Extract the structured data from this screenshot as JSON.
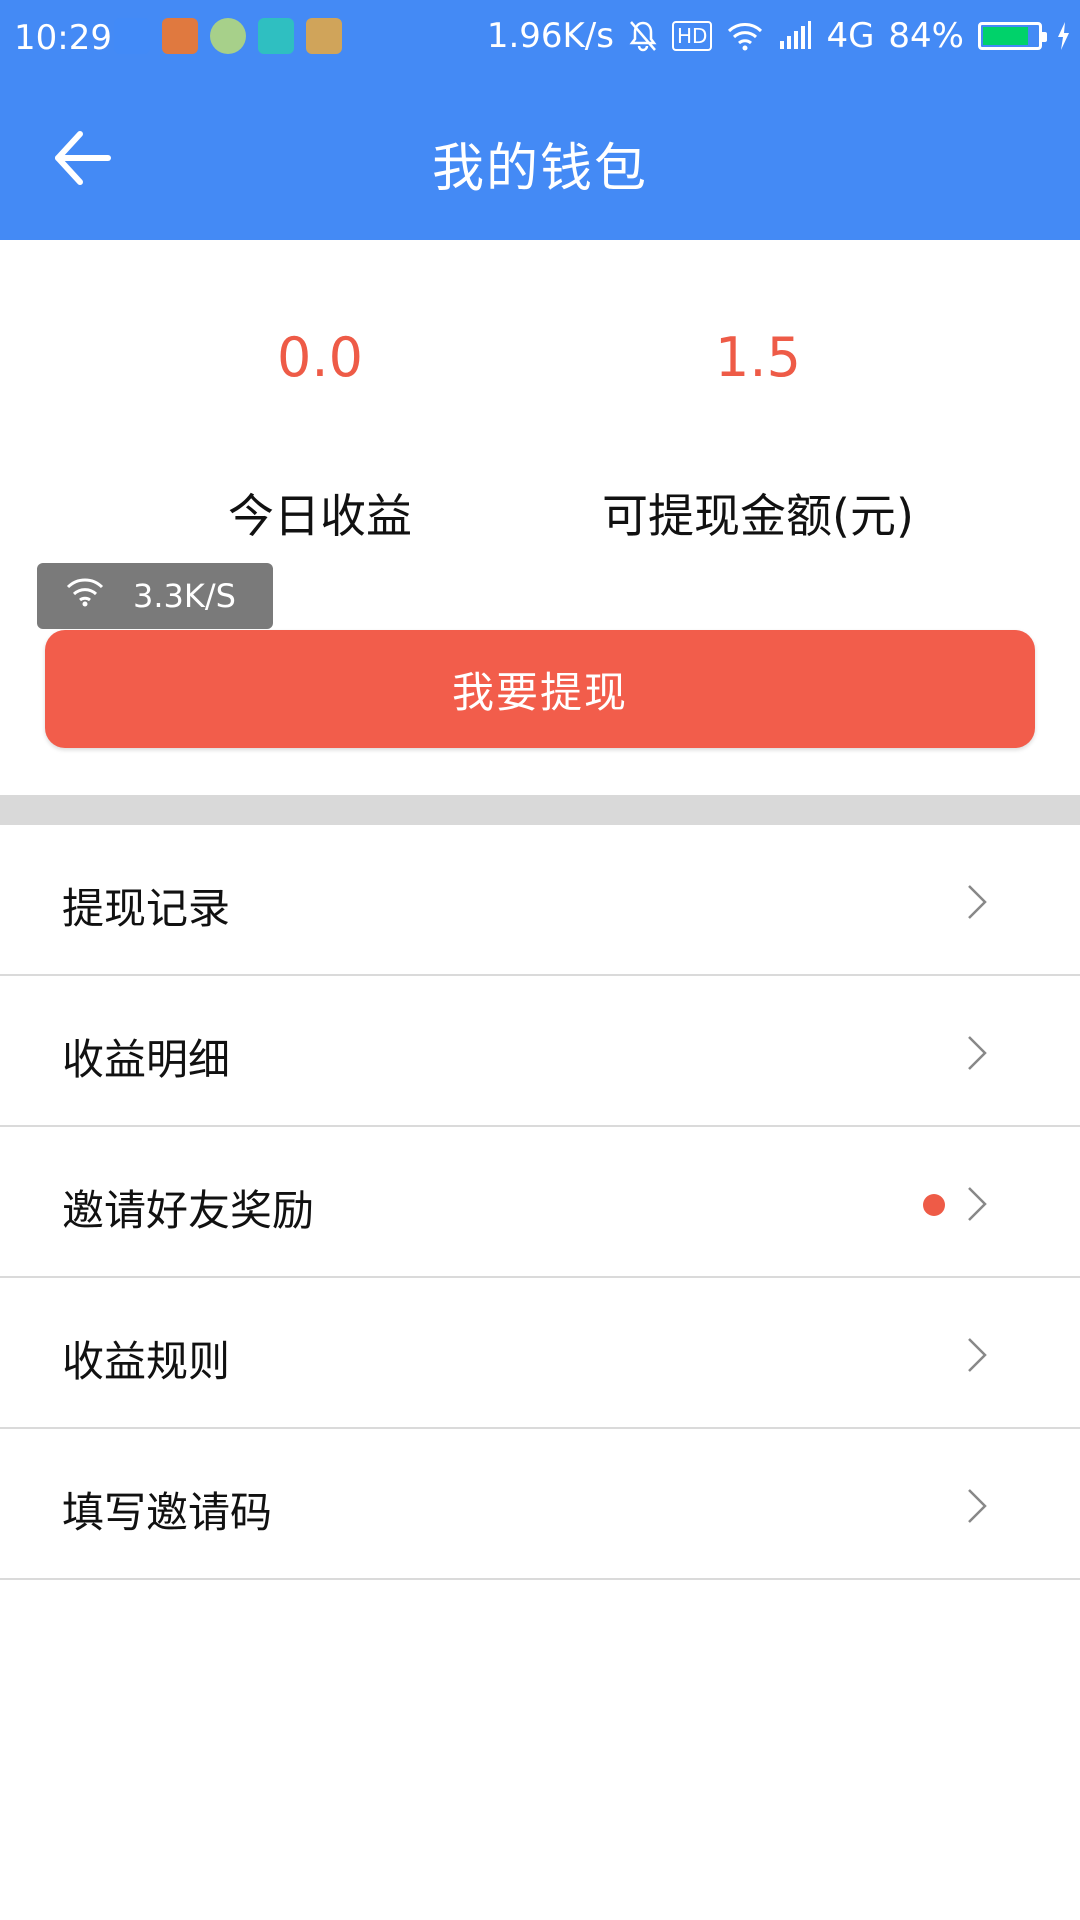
{
  "status_bar": {
    "time": "10:29",
    "network_speed": "1.96K/s",
    "hd_label": "HD",
    "network_type": "4G",
    "battery_percent": "84%",
    "battery_level": 0.84,
    "notification_icons": [
      {
        "icon": "app-notification-icon",
        "color": "#3D8CFF"
      },
      {
        "icon": "app-notification-icon",
        "color": "#E0793F"
      },
      {
        "icon": "app-notification-icon",
        "color": "#A7D08A"
      },
      {
        "icon": "app-notification-icon",
        "color": "#2FBFC1"
      },
      {
        "icon": "app-notification-icon",
        "color": "#D0A45A"
      }
    ]
  },
  "header": {
    "title": "我的钱包",
    "back_icon": "arrow-left-icon"
  },
  "summary": {
    "today_earnings_value": "0.0",
    "today_earnings_label": "今日收益",
    "withdrawable_value": "1.5",
    "withdrawable_label": "可提现金额(元)"
  },
  "speed_badge": {
    "text": "3.3K/S"
  },
  "withdraw_button": {
    "label": "我要提现"
  },
  "menu": {
    "items": [
      {
        "label": "提现记录",
        "badge": false
      },
      {
        "label": "收益明细",
        "badge": false
      },
      {
        "label": "邀请好友奖励",
        "badge": true
      },
      {
        "label": "收益规则",
        "badge": false
      },
      {
        "label": "填写邀请码",
        "badge": false
      }
    ]
  },
  "colors": {
    "primary": "#448AF5",
    "accent": "#F25D4B",
    "value_text": "#EE5B47"
  }
}
